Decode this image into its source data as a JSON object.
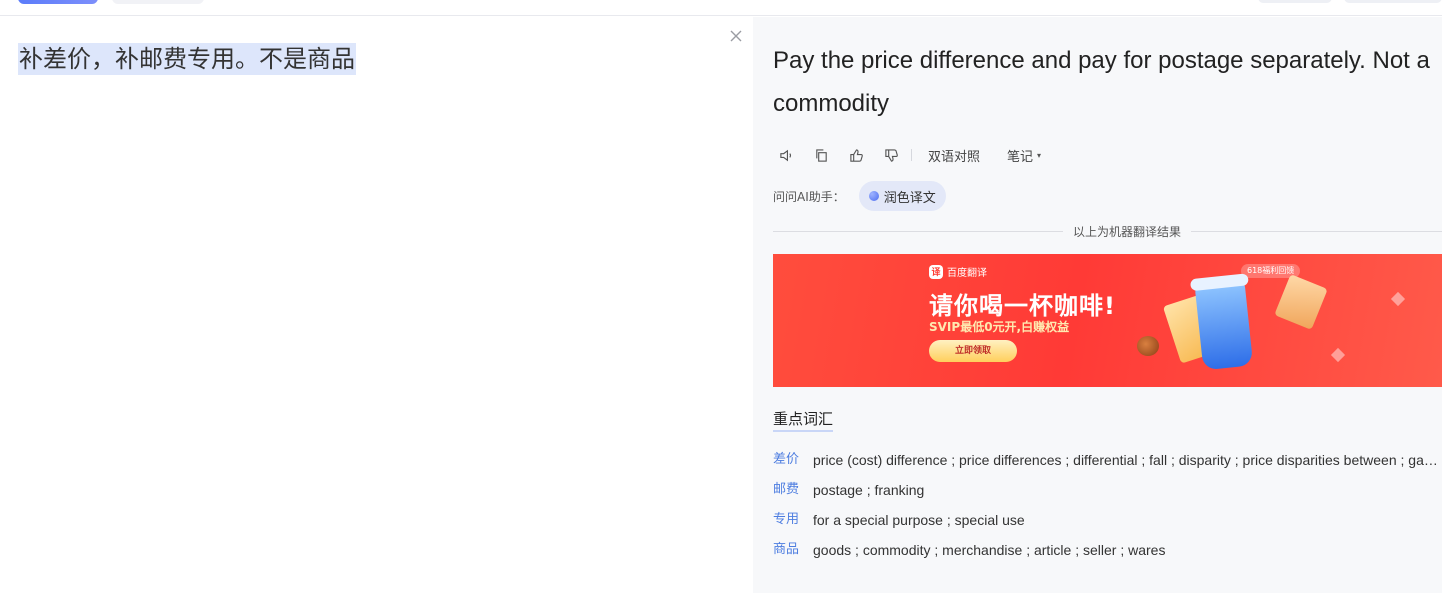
{
  "source": {
    "text": "补差价，补邮费专用。不是商品",
    "close_icon": "close-icon"
  },
  "result": {
    "translation": "Pay the price difference and pay for postage separately. Not a commodity",
    "toolbar": {
      "icons": [
        "speaker-icon",
        "copy-icon",
        "thumbs-up-icon",
        "thumbs-down-icon"
      ],
      "bilingual_label": "双语对照",
      "notes_label": "笔记",
      "notes_caret": "▾"
    },
    "ai": {
      "label": "问问AI助手：",
      "chip_label": "润色译文"
    },
    "divider_text": "以上为机器翻译结果",
    "banner": {
      "logo_mark": "译",
      "logo_text": "百度翻译",
      "badge": "618福利回馈",
      "headline": "请你喝一杯咖啡!",
      "subline": "SVIP最低0元开,白赚权益",
      "cta": "立即领取",
      "colors": {
        "primary": "#ff3a36",
        "cta": "#ffcf5c"
      }
    },
    "vocab": {
      "title": "重点词汇",
      "items": [
        {
          "term": "差价",
          "def": "price (cost) difference ; price differences ; differential ; fall ; disparity ; price disparities between ; gap between"
        },
        {
          "term": "邮费",
          "def": "postage ; franking"
        },
        {
          "term": "专用",
          "def": "for a special purpose ; special use"
        },
        {
          "term": "商品",
          "def": "goods ; commodity ; merchandise ; article ; seller ; wares"
        }
      ]
    }
  },
  "colors": {
    "accent": "#4d7de0",
    "selection": "#dde6fb",
    "panel": "#f7f8fa"
  }
}
